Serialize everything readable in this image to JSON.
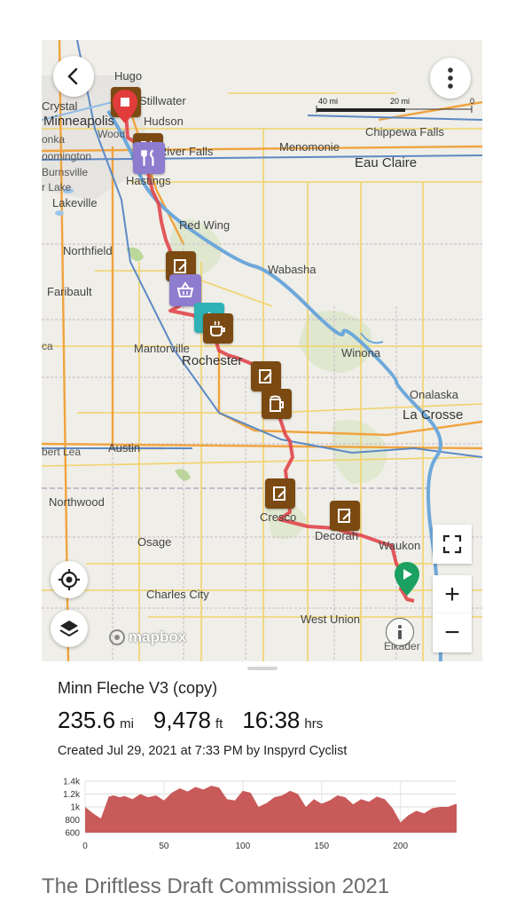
{
  "map": {
    "place_labels": {
      "hugo": "Hugo",
      "stillwater": "Stillwater",
      "crystal": "Crystal",
      "minneapolis": "Minneapolis",
      "hudson": "Hudson",
      "onka": "onka",
      "wood": "Wood",
      "river_falls": "River Falls",
      "menomonie": "Menomonie",
      "chippewa_falls": "Chippewa Falls",
      "bloomington": "oomington",
      "burnsville": "Burnsville",
      "prior_lake": "r Lake",
      "eau_claire": "Eau Claire",
      "hastings": "Hastings",
      "lakeville": "Lakeville",
      "red_wing": "Red Wing",
      "northfield": "Northfield",
      "wabasha": "Wabasha",
      "faribault": "Faribault",
      "mantorville": "Mantorville",
      "rochester": "Rochester",
      "winona": "Winona",
      "ca": "ca",
      "onalaska": "Onalaska",
      "la_crosse": "La Crosse",
      "austin": "Austin",
      "albert_lea": "bert Lea",
      "northwood": "Northwood",
      "cresco": "Cresco",
      "decorah": "Decorah",
      "waukon": "Waukon",
      "osage": "Osage",
      "charles_city": "Charles City",
      "west_union": "West Union",
      "elkader": "Elkader"
    },
    "scale": {
      "label_40": "40 mi",
      "label_20": "20 mi",
      "label_0": "0"
    },
    "attribution": "mapbox",
    "route_color": "#e0464b",
    "poi_colors": {
      "brown": "#7b4a12",
      "purple": "#8e7ccf",
      "teal": "#2fb2b6",
      "start": "#1aa060",
      "end": "#e23b3b"
    },
    "icons": {
      "back": "chevron-left-icon",
      "more": "more-vertical-icon",
      "locate": "locate-target-icon",
      "layers": "layers-icon",
      "fullscreen": "fullscreen-icon",
      "zoom_in": "plus-icon",
      "zoom_out": "minus-icon",
      "info": "info-icon"
    },
    "controls": {
      "zoom_in": "+",
      "zoom_out": "−"
    }
  },
  "route": {
    "name": "Minn Fleche V3 (copy)",
    "distance_value": "235.6",
    "distance_unit": "mi",
    "elevation_value": "9,478",
    "elevation_unit": "ft",
    "time_value": "16:38",
    "time_unit": "hrs",
    "created": "Created Jul 29, 2021 at 7:33 PM by Inspyrd Cyclist"
  },
  "chart_data": {
    "type": "area",
    "xlim": [
      0,
      235.6
    ],
    "ylim": [
      600,
      1400
    ],
    "x_ticks": [
      "0",
      "50",
      "100",
      "150",
      "200"
    ],
    "y_ticks": [
      "1.4k",
      "1.2k",
      "1k",
      "800",
      "600"
    ],
    "fill_color": "#c95a5a",
    "x": [
      0,
      5,
      10,
      15,
      18,
      22,
      25,
      30,
      35,
      40,
      45,
      50,
      55,
      60,
      65,
      70,
      75,
      80,
      85,
      90,
      95,
      100,
      105,
      110,
      115,
      120,
      125,
      130,
      135,
      140,
      145,
      150,
      155,
      160,
      165,
      170,
      175,
      180,
      185,
      190,
      195,
      200,
      205,
      210,
      215,
      220,
      225,
      230,
      235.6
    ],
    "y": [
      1000,
      900,
      820,
      1160,
      1180,
      1150,
      1170,
      1120,
      1200,
      1150,
      1180,
      1100,
      1220,
      1290,
      1240,
      1310,
      1270,
      1330,
      1300,
      1120,
      1100,
      1250,
      1220,
      1000,
      1060,
      1150,
      1180,
      1250,
      1200,
      1000,
      1120,
      1050,
      1100,
      1180,
      1150,
      1040,
      1120,
      1080,
      1160,
      1120,
      980,
      760,
      870,
      940,
      900,
      980,
      1000,
      1000,
      1050
    ]
  },
  "footer": {
    "title": "The Driftless Draft Commission 2021"
  }
}
